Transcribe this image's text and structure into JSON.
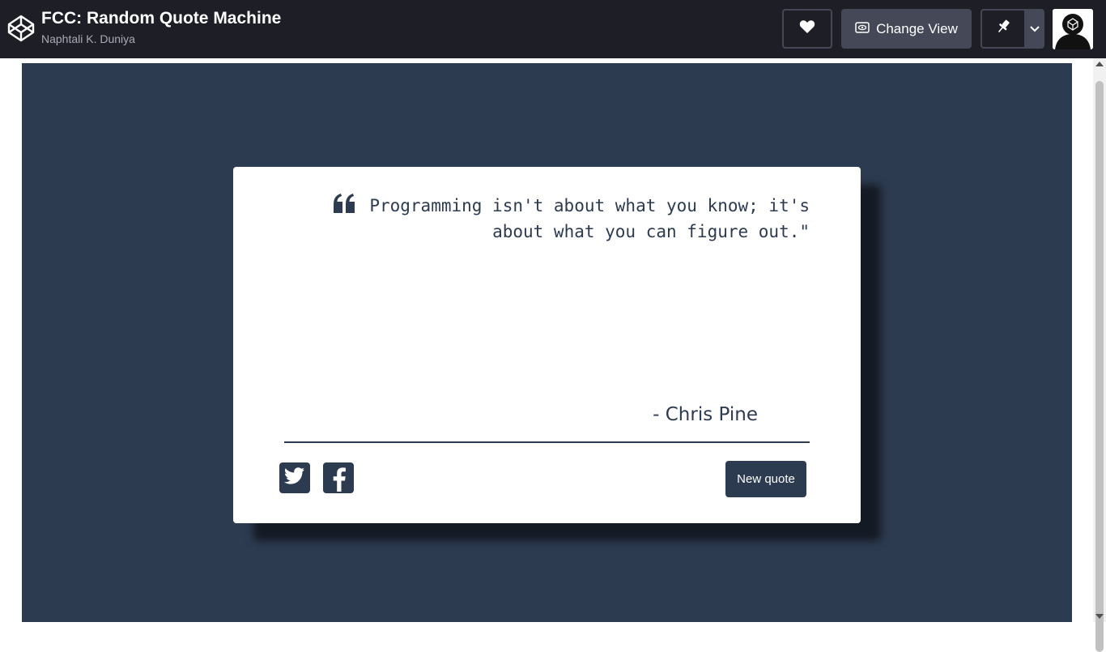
{
  "header": {
    "pen_title": "FCC: Random Quote Machine",
    "author": "Naphtali K. Duniya",
    "change_view_label": "Change View",
    "icons": [
      "codepen-logo-icon",
      "heart-icon",
      "eye-icon",
      "pin-icon",
      "chevron-down-icon"
    ]
  },
  "quote": {
    "text": "Programming isn't about what you know; it's about what you can figure out.\"",
    "author": "- Chris Pine",
    "new_quote_label": "New quote",
    "share_icons": [
      "twitter-icon",
      "facebook-icon"
    ]
  },
  "colors": {
    "topbar": "#1e1f26",
    "background": "#2d3b51",
    "card": "#ffffff",
    "accent": "#2d3b51"
  }
}
